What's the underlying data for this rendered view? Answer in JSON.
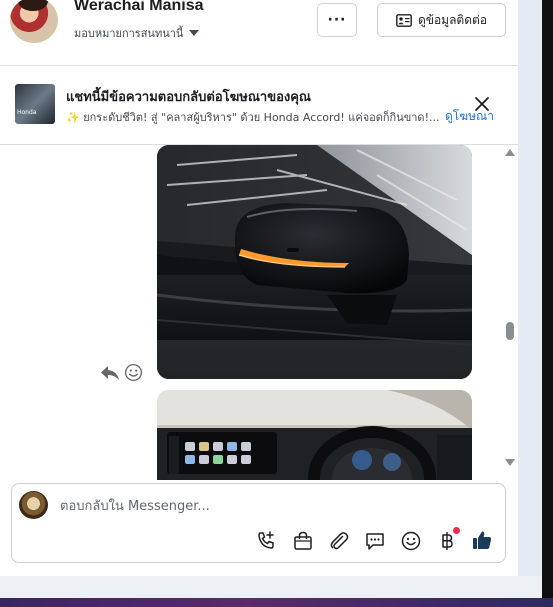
{
  "header": {
    "contact_name": "Werachai Manisa",
    "assign_label": "มอบหมายการสนทนานี้",
    "more_label": "···",
    "contact_info_label": "ดูข้อมูลติดต่อ"
  },
  "ad_banner": {
    "title": "แชทนี้มีข้อความตอบกลับต่อโฆษณาของคุณ",
    "text": "✨ ยกระดับชีวิต! สู่ \"คลาสผู้บริหาร\" ด้วย Honda Accord! แค่จอดก็กินขาด!...",
    "link": "ดูโฆษณา"
  },
  "composer": {
    "placeholder": "ตอบกลับใน Messenger..."
  },
  "colors": {
    "accent": "#216fdb",
    "like": "#1c3b5a",
    "badge": "#f02849"
  },
  "icons": [
    "chevron-down-icon",
    "ellipsis-icon",
    "contact-card-icon",
    "close-icon",
    "reply-icon",
    "smiley-react-icon",
    "scroll-up-icon",
    "scroll-down-icon",
    "add-call-icon",
    "shopping-bag-icon",
    "paperclip-icon",
    "saved-reply-icon",
    "emoji-icon",
    "baht-payment-icon",
    "thumbs-up-icon"
  ]
}
